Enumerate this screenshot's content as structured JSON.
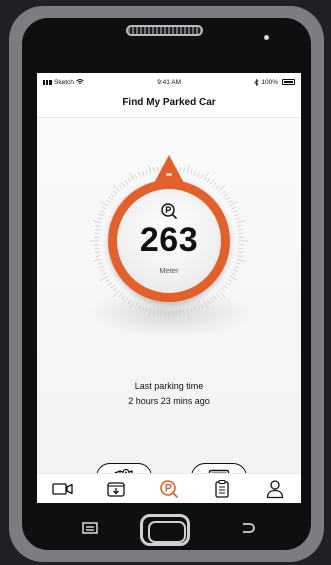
{
  "statusbar": {
    "carrier": "Sketch",
    "time": "9:41 AM",
    "battery": "100%"
  },
  "header": {
    "title": "Find My Parked Car"
  },
  "gauge": {
    "distance": "263",
    "unit": "Meter",
    "accent_color": "#e3602a"
  },
  "parking": {
    "label": "Last parking time",
    "value": "2 hours 23 mins ago"
  },
  "actions": [
    {
      "name": "map-pin-button",
      "icon": "map-pin-icon"
    },
    {
      "name": "photo-button",
      "icon": "image-icon"
    }
  ],
  "tabs": [
    {
      "name": "tab-video",
      "icon": "video-camera-icon",
      "active": false
    },
    {
      "name": "tab-download",
      "icon": "download-box-icon",
      "active": false
    },
    {
      "name": "tab-parking",
      "icon": "parking-search-icon",
      "active": true
    },
    {
      "name": "tab-notes",
      "icon": "clipboard-icon",
      "active": false
    },
    {
      "name": "tab-profile",
      "icon": "user-icon",
      "active": false
    }
  ]
}
